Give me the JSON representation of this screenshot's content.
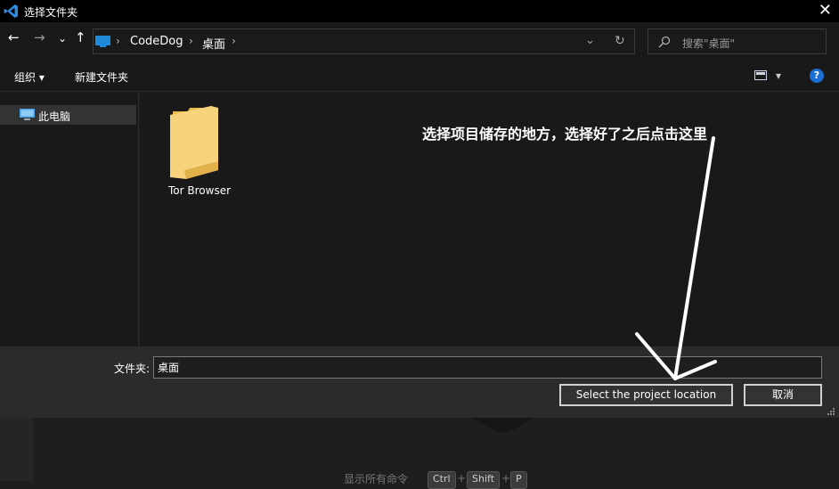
{
  "window": {
    "title": "选择文件夹",
    "close_label": "✕"
  },
  "nav": {
    "back": "←",
    "forward": "→",
    "recent": "⌄",
    "up": "↑",
    "breadcrumb": [
      "CodeDog",
      "桌面"
    ],
    "separator": "›",
    "dropdown": "⌄",
    "refresh": "↻",
    "search_placeholder": "搜索\"桌面\""
  },
  "commands": {
    "organize": "组织 ▾",
    "new_folder": "新建文件夹",
    "view_caret": "▾",
    "help": "?"
  },
  "sidebar": {
    "items": [
      {
        "label": "此电脑"
      }
    ]
  },
  "content": {
    "items": [
      {
        "name": "Tor Browser"
      }
    ]
  },
  "annotation": {
    "text": "选择项目储存的地方，选择好了之后点击这里"
  },
  "footer": {
    "folder_label": "文件夹:",
    "folder_value": "桌面",
    "select_button": "Select the project location",
    "cancel_button": "取消"
  },
  "background_hint": {
    "text": "显示所有命令",
    "keys": [
      "Ctrl",
      "+",
      "Shift",
      "+",
      "P"
    ]
  },
  "colors": {
    "accent": "#0e6fd1",
    "help_blue": "#1b6fd3",
    "folder": "#f5cd6a"
  }
}
